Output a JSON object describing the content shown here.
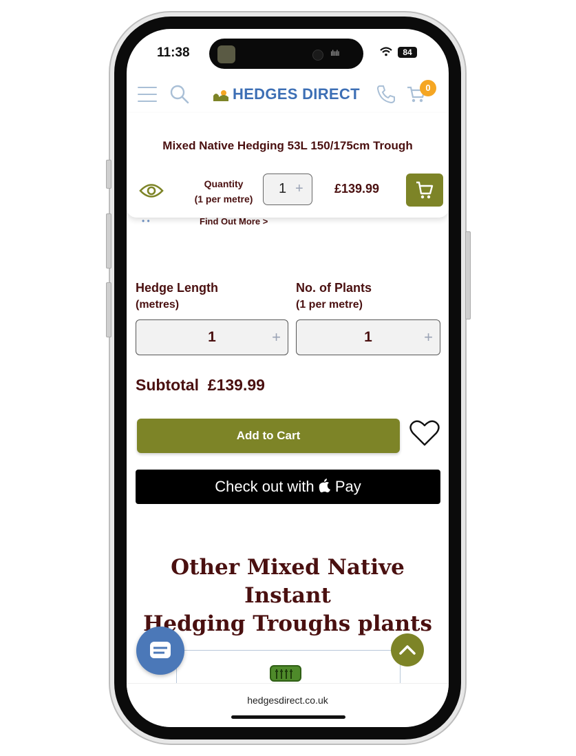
{
  "status_bar": {
    "time": "11:38",
    "battery": "84"
  },
  "header": {
    "brand": "HEDGES DIRECT",
    "cart_count": "0"
  },
  "sticky_bar": {
    "product_title": "Mixed Native Hedging 53L 150/175cm Trough",
    "quantity_label_line1": "Quantity",
    "quantity_label_line2": "(1 per metre)",
    "quantity_value": "1",
    "price": "£139.99"
  },
  "find_out_more": "Find Out More >",
  "hedge_length": {
    "label": "Hedge Length",
    "sublabel": "(metres)",
    "value": "1"
  },
  "plants": {
    "label": "No. of Plants",
    "sublabel": "(1 per metre)",
    "value": "1"
  },
  "subtotal": {
    "label": "Subtotal",
    "value": "£139.99"
  },
  "buttons": {
    "add_to_cart": "Add to Cart",
    "apple_pay_prefix": "Check out with",
    "apple_pay_suffix": "Pay"
  },
  "section_heading": {
    "line1": "Other Mixed Native Instant",
    "line2": "Hedging Troughs plants"
  },
  "url": "hedgesdirect.co.uk",
  "colors": {
    "olive": "#7d8427",
    "maroon": "#4a1010",
    "brand_blue": "#3d6fb5",
    "badge": "#f5a623",
    "chat": "#4b78b8"
  },
  "icons": [
    "menu-icon",
    "search-icon",
    "logo-icon",
    "phone-icon",
    "cart-icon",
    "eye-icon",
    "cart-icon",
    "plus-icon",
    "heart-icon",
    "apple-icon",
    "chat-icon",
    "arrow-up-icon",
    "tree-icon"
  ]
}
